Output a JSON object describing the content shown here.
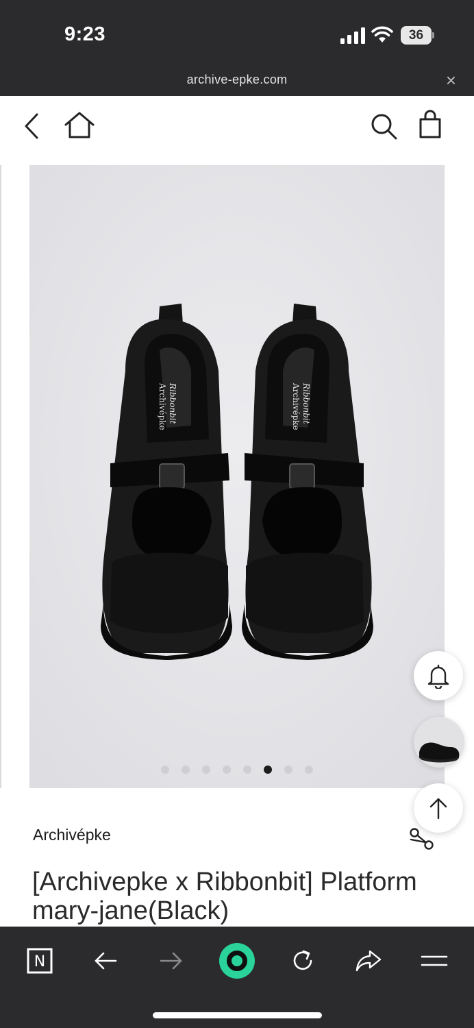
{
  "status_bar": {
    "time": "9:23",
    "battery": "36"
  },
  "browser": {
    "url": "archive-epke.com",
    "close_label": "×"
  },
  "carousel": {
    "slide_count": 8,
    "active_index": 5
  },
  "product": {
    "brand": "Archivépke",
    "title": "[Archivepke x Ribbonbit] Platform mary-jane(Black)",
    "image_alt": "Black platform mary-jane shoes, top view",
    "insole_brand": "Ribbonbit",
    "insole_text": "Archivépke"
  },
  "icons": {
    "header": [
      "back-icon",
      "home-icon",
      "search-icon",
      "shopping-bag-icon"
    ],
    "floating": [
      "bell-icon",
      "recent-product-thumbnail",
      "scroll-top-icon"
    ],
    "toolbar": [
      "notion-icon",
      "back-arrow-icon",
      "forward-arrow-icon",
      "browser-home-icon",
      "reload-icon",
      "share-arrow-icon",
      "menu-icon"
    ]
  },
  "toolbar": {
    "notion_label": "N"
  },
  "colors": {
    "chrome": "#2b2b2d",
    "accent": "#2ad39a",
    "image_bg": "#e6e6e9"
  }
}
